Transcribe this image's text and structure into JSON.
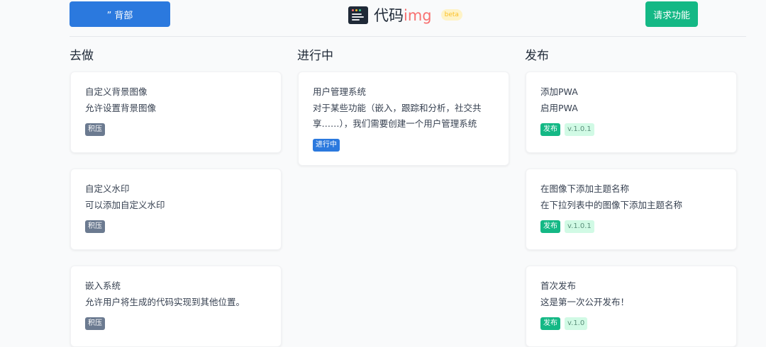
{
  "header": {
    "back_button": "” 背部",
    "logo_text": "代码",
    "logo_suffix": "img",
    "badge": "beta",
    "request_button": "请求功能"
  },
  "columns": [
    {
      "title": "去做",
      "cards": [
        {
          "title": "自定义背景图像",
          "desc": "允许设置背景图像",
          "tags": [
            "积压"
          ]
        },
        {
          "title": "自定义水印",
          "desc": "可以添加自定义水印",
          "tags": [
            "积压"
          ]
        },
        {
          "title": "嵌入系统",
          "desc": "允许用户将生成的代码实现到其他位置。",
          "tags": [
            "积压"
          ]
        }
      ]
    },
    {
      "title": "进行中",
      "cards": [
        {
          "title": "用户管理系统",
          "desc": "对于某些功能（嵌入，跟踪和分析，社交共享……），我们需要创建一个用户管理系统",
          "tags": [
            "进行中"
          ]
        }
      ]
    },
    {
      "title": "发布",
      "cards": [
        {
          "title": "添加PWA",
          "desc": "启用PWA",
          "tags": [
            "发布",
            "v.1.0.1"
          ]
        },
        {
          "title": "在图像下添加主题名称",
          "desc": "在下拉列表中的图像下添加主题名称",
          "tags": [
            "发布",
            "v.1.0.1"
          ]
        },
        {
          "title": "首次发布",
          "desc": "这是第一次公开发布！",
          "tags": [
            "发布",
            "v.1.0"
          ]
        }
      ]
    }
  ],
  "colors": {
    "primary_blue": "#2b79de",
    "release_green": "#14b885",
    "backlog_gray": "#6b7a90"
  }
}
